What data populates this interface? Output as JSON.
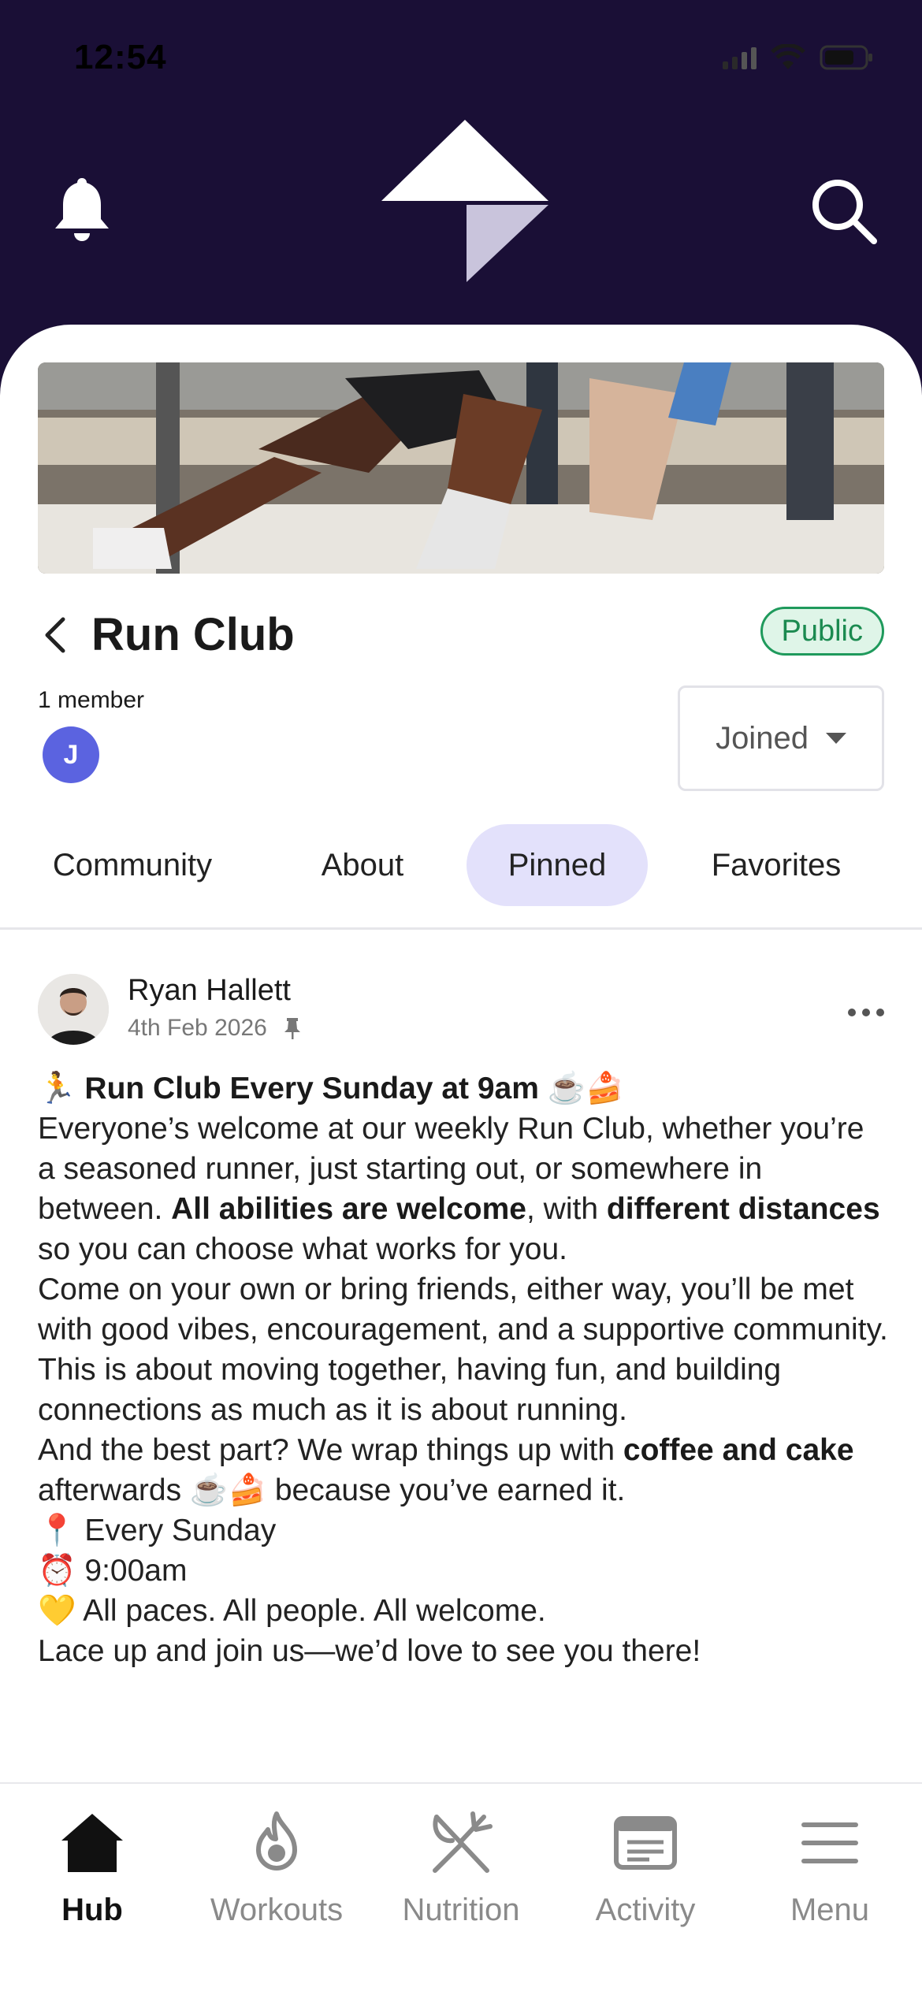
{
  "status_bar": {
    "time": "12:54"
  },
  "header": {
    "bell_icon": "bell-icon",
    "logo_icon": "app-logo",
    "search_icon": "search-icon"
  },
  "group": {
    "title": "Run Club",
    "visibility": "Public",
    "member_count": "1 member",
    "member_initial": "J",
    "join_state": "Joined"
  },
  "tabs": [
    {
      "label": "Community"
    },
    {
      "label": "About"
    },
    {
      "label": "Pinned"
    },
    {
      "label": "Favorites"
    }
  ],
  "active_tab": "Pinned",
  "post": {
    "author": "Ryan Hallett",
    "date": "4th Feb 2026",
    "heading_emoji": "🏃",
    "heading": "Run Club Every Sunday at 9am",
    "heading_trailing_emoji": "☕🍰",
    "p1_a": "Everyone’s welcome at our weekly Run Club, whether you’re a seasoned runner, just starting out, or somewhere in between. ",
    "p1_b1": "All abilities are welcome",
    "p1_c": ", with ",
    "p1_b2": "different distances",
    "p1_d": " so you can choose what works for you.",
    "p2": "Come on your own or bring friends, either way, you’ll be met with good vibes, encouragement, and a supportive community. This is about moving together, having fun, and building connections as much as it is about running.",
    "p3_a": "And the best part? We wrap things up with ",
    "p3_b": "coffee and cake",
    "p3_c": " afterwards ☕🍰 because you’ve earned it.",
    "line_day": "📍 Every Sunday",
    "line_time": "⏰ 9:00am",
    "line_all": "💛 All paces. All people. All welcome.",
    "closing": "Lace up and join us—we’d love to see you there!"
  },
  "bottom_nav": [
    {
      "label": "Hub",
      "icon": "home-icon",
      "active": true
    },
    {
      "label": "Workouts",
      "icon": "flame-icon",
      "active": false
    },
    {
      "label": "Nutrition",
      "icon": "fork-knife-icon",
      "active": false
    },
    {
      "label": "Activity",
      "icon": "newspaper-icon",
      "active": false
    },
    {
      "label": "Menu",
      "icon": "hamburger-icon",
      "active": false
    }
  ],
  "colors": {
    "header_bg": "#1a0f36",
    "public_green": "#1b8a50",
    "active_tab_bg": "#e3e1fb",
    "avatar_blue": "#5b63e0"
  }
}
